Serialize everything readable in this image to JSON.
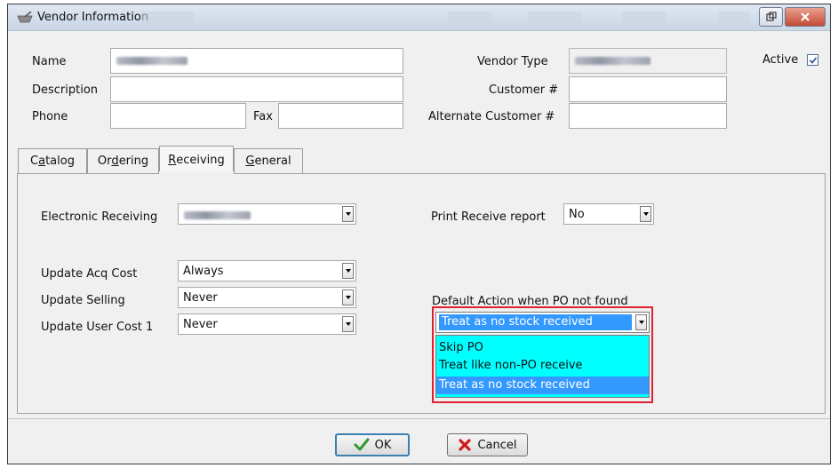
{
  "window": {
    "title": "Vendor Information"
  },
  "header_fields": {
    "name_label": "Name",
    "description_label": "Description",
    "phone_label": "Phone",
    "fax_label": "Fax",
    "vendor_type_label": "Vendor Type",
    "customer_no_label": "Customer #",
    "alt_customer_no_label": "Alternate Customer #",
    "active_label": "Active",
    "active_checked": true
  },
  "tabs": [
    {
      "pre": "C",
      "u": "a",
      "post": "talog"
    },
    {
      "pre": "Or",
      "u": "d",
      "post": "ering"
    },
    {
      "pre": "",
      "u": "R",
      "post": "eceiving"
    },
    {
      "pre": "",
      "u": "G",
      "post": "eneral"
    }
  ],
  "receiving": {
    "electronic_receiving_label": "Electronic Receiving",
    "print_receive_report_label": "Print Receive report",
    "print_receive_report_value": "No",
    "update_acq_cost_label": "Update Acq Cost",
    "update_acq_cost_value": "Always",
    "update_selling_label": "Update Selling",
    "update_selling_value": "Never",
    "update_user_cost_label": "Update User Cost 1",
    "update_user_cost_value": "Never",
    "default_action_label": "Default Action when PO not found",
    "default_action_value": "Treat as no stock received",
    "default_action_options": [
      "Skip PO",
      "Treat like non-PO receive",
      "Treat as no stock received"
    ],
    "default_action_selected_index": 2
  },
  "buttons": {
    "ok_label": "OK",
    "cancel_label": "Cancel"
  },
  "colors": {
    "dropdown_list_bg": "#00ffff",
    "selection_bg": "#3399ff",
    "highlight_border": "#e02030"
  }
}
